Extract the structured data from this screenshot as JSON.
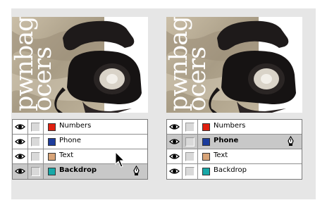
{
  "panels": [
    {
      "id": "left",
      "art_words": [
        "pwnbag",
        "ocers"
      ],
      "layers": [
        {
          "name": "Numbers",
          "color": "#e02010",
          "selected": false
        },
        {
          "name": "Phone",
          "color": "#1c3c9c",
          "selected": false
        },
        {
          "name": "Text",
          "color": "#d8a478",
          "selected": false
        },
        {
          "name": "Backdrop",
          "color": "#18a8a8",
          "selected": true
        }
      ]
    },
    {
      "id": "right",
      "art_words": [
        "pwnbag",
        "ocers"
      ],
      "layers": [
        {
          "name": "Numbers",
          "color": "#e02010",
          "selected": false
        },
        {
          "name": "Phone",
          "color": "#1c3c9c",
          "selected": true
        },
        {
          "name": "Text",
          "color": "#d8a478",
          "selected": false
        },
        {
          "name": "Backdrop",
          "color": "#18a8a8",
          "selected": false
        }
      ]
    }
  ],
  "icons": {
    "eye": "eye-icon",
    "pen": "pen-nib-icon",
    "cursor": "arrow-cursor-icon"
  },
  "colors": {
    "frame_bg": "#e6e6e6",
    "selected_row": "#c8c8c8",
    "photo_bg": "#b5aa93"
  }
}
